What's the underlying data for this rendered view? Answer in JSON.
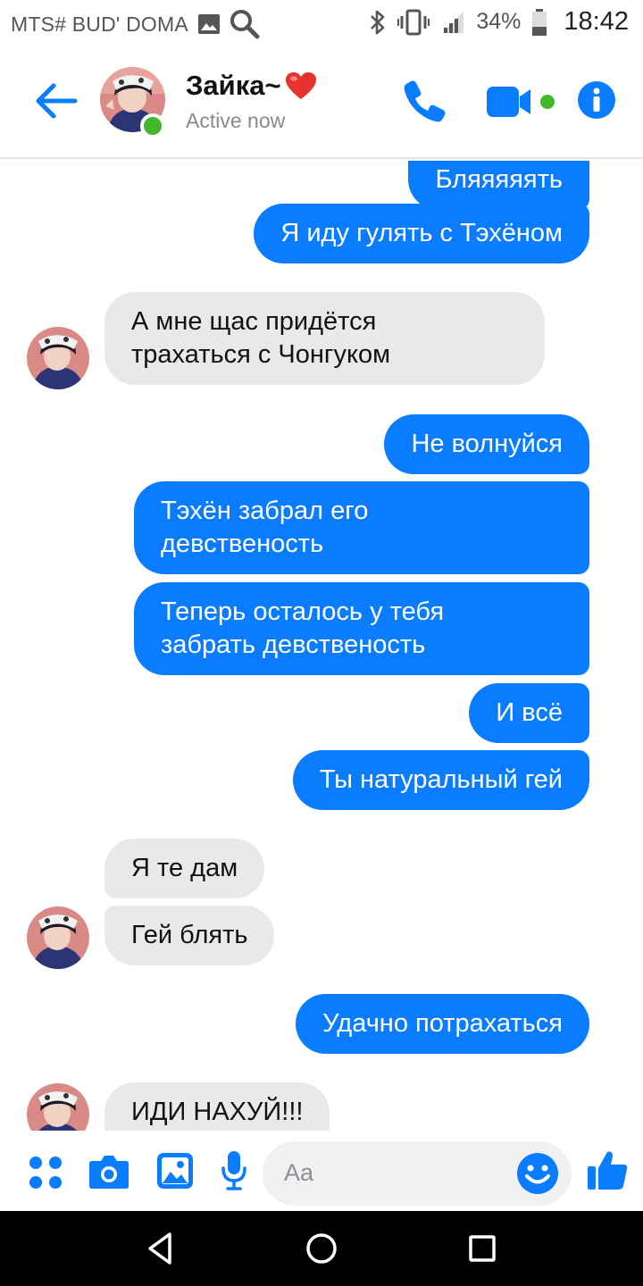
{
  "status_bar": {
    "carrier": "MTS# BUD' DOMA",
    "battery_percent": "34%",
    "time": "18:42",
    "icons": [
      "gallery-icon",
      "search-icon",
      "bluetooth-icon",
      "vibrate-icon",
      "signal-icon",
      "battery-icon"
    ]
  },
  "header": {
    "contact_name": "Зайка~",
    "name_emoji": "heart-icon",
    "status": "Active now",
    "accent_color": "#0a7cff",
    "online_color": "#42b72a"
  },
  "messages": [
    {
      "side": "out",
      "text": "Бляяяяять"
    },
    {
      "side": "out",
      "text": "Я иду гулять с Тэхёном"
    },
    {
      "side": "in",
      "lines": [
        "А мне щас придётся",
        "трахаться с Чонгуком"
      ]
    },
    {
      "side": "out",
      "text": "Не волнуйся"
    },
    {
      "side": "out",
      "lines": [
        "Тэхён забрал его",
        "девственость"
      ]
    },
    {
      "side": "out",
      "lines": [
        "Теперь осталось у тебя",
        "забрать девственость"
      ]
    },
    {
      "side": "out",
      "text": "И всё"
    },
    {
      "side": "out",
      "text": "Ты натуральный гей"
    },
    {
      "side": "in",
      "text": "Я те дам"
    },
    {
      "side": "in",
      "text": "Гей блять"
    },
    {
      "side": "out",
      "text": "Удачно потрахаться"
    },
    {
      "side": "in",
      "text": "ИДИ НАХУЙ!!!"
    }
  ],
  "composer": {
    "placeholder": "Aa",
    "icons": [
      "apps-icon",
      "camera-icon",
      "photo-icon",
      "microphone-icon",
      "emoji-icon",
      "thumbs-up-icon"
    ]
  },
  "navbar": {
    "icons": [
      "back-triangle-icon",
      "home-circle-icon",
      "recents-square-icon"
    ]
  }
}
